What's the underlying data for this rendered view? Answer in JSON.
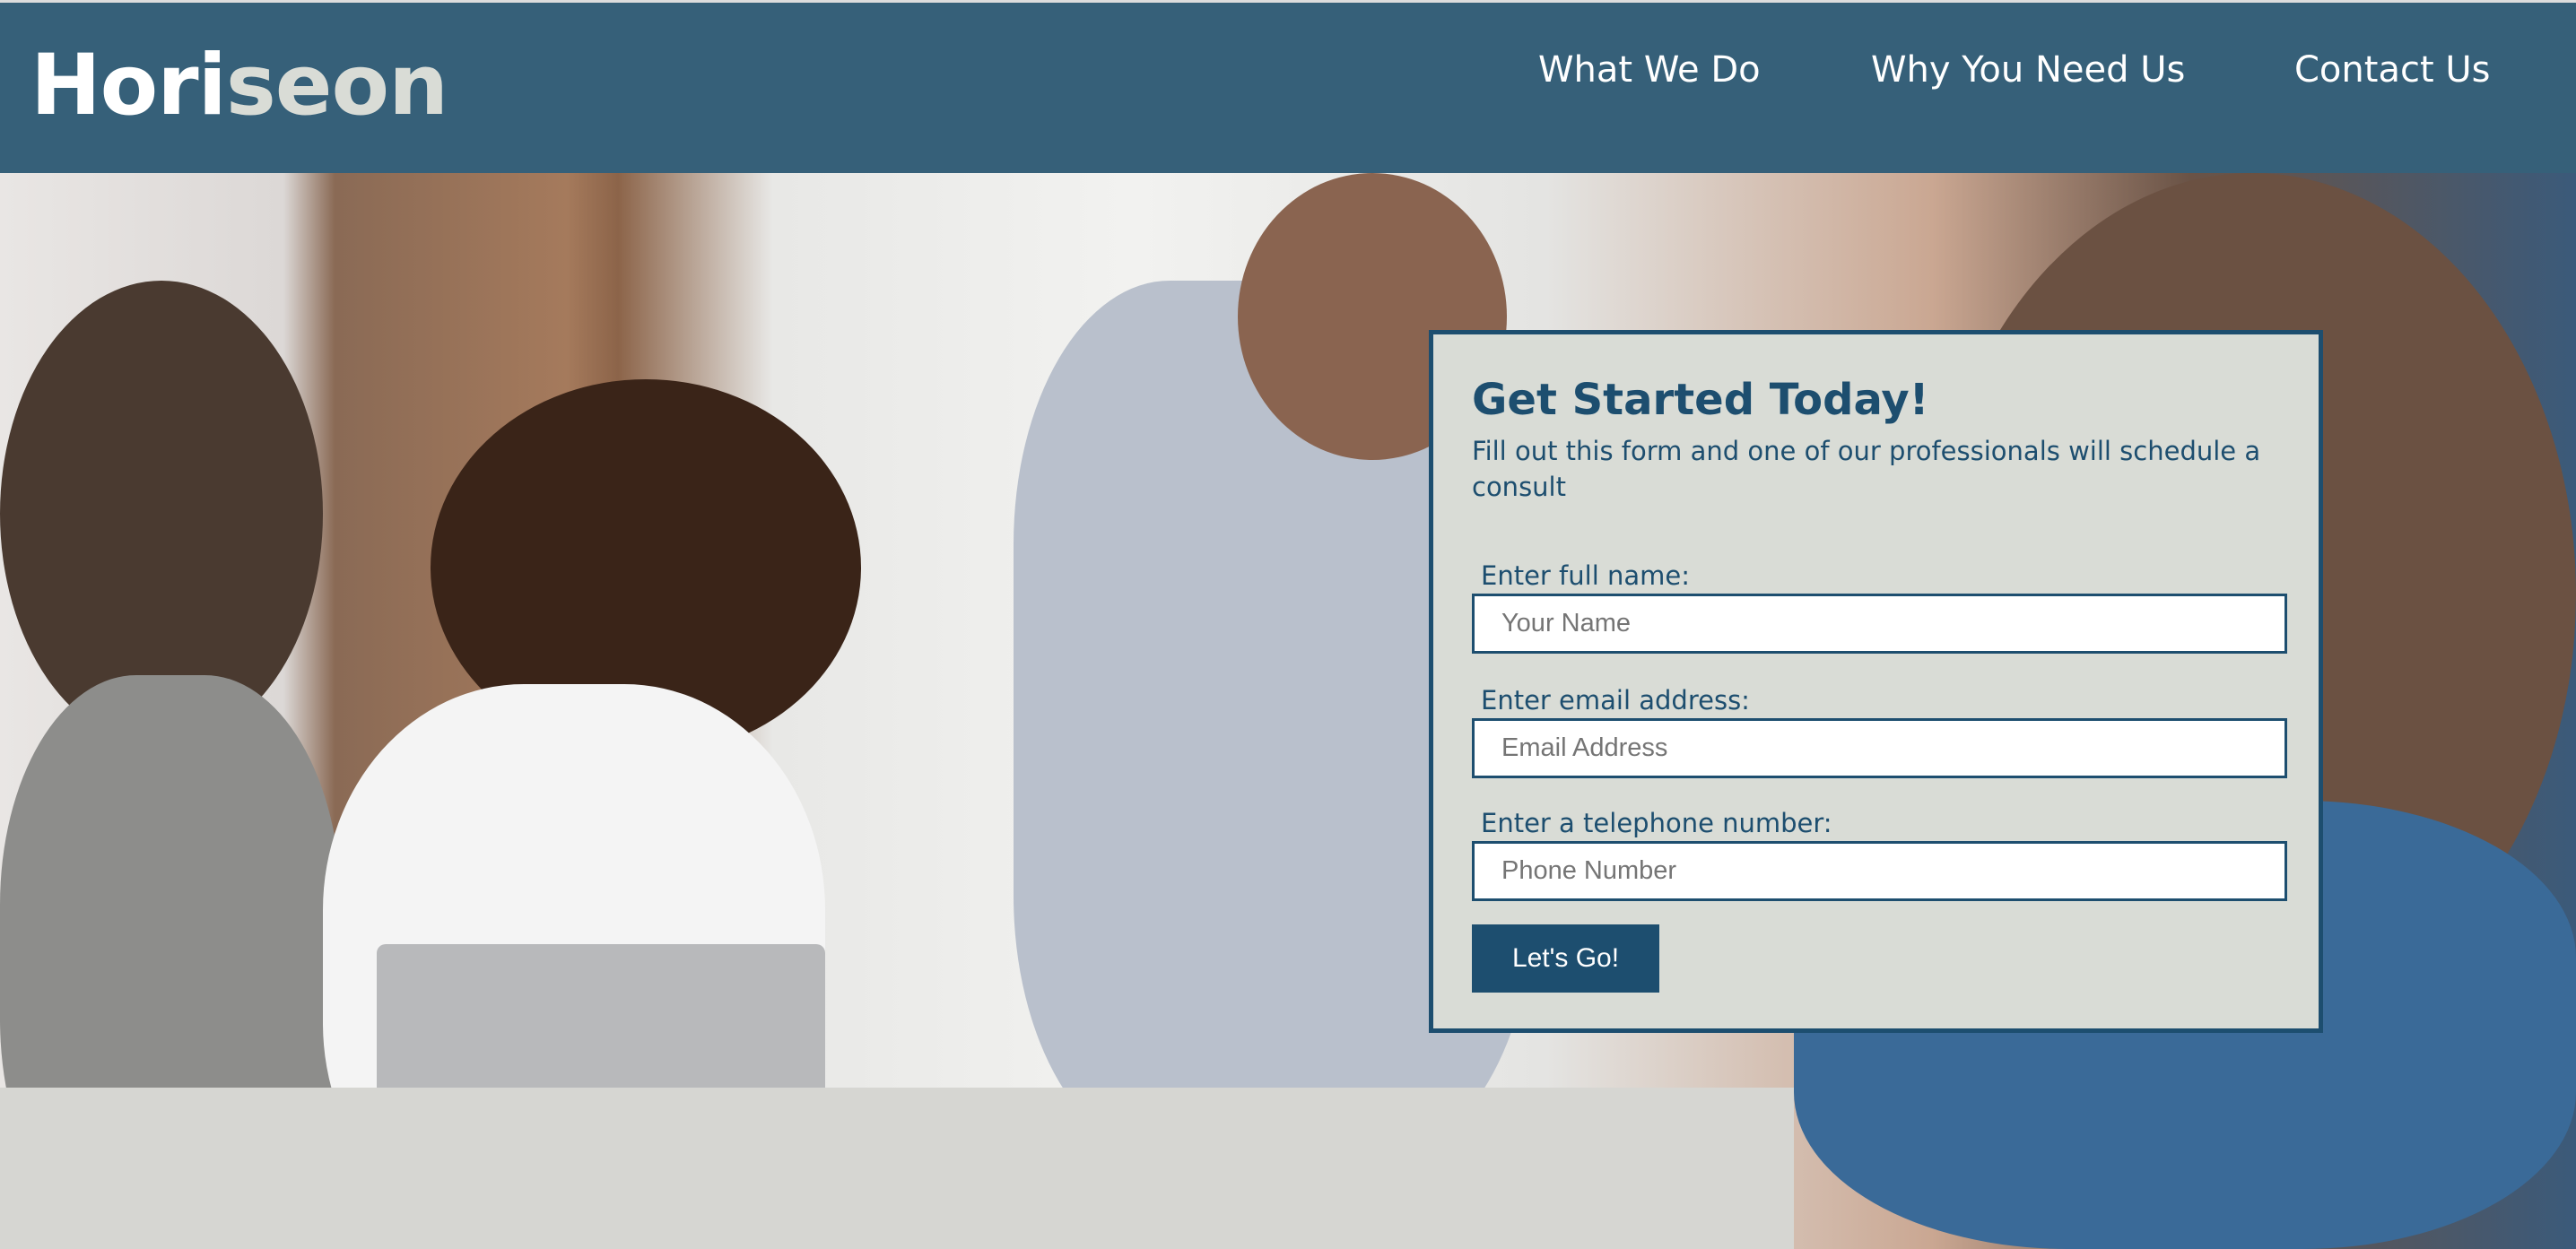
{
  "header": {
    "logo_part1": "Hori",
    "logo_part2": "seon",
    "nav": [
      "What We Do",
      "Why You Need Us",
      "Contact Us"
    ]
  },
  "form": {
    "title": "Get Started Today!",
    "description": "Fill out this form and one of our professionals will schedule a consult",
    "fields": [
      {
        "label": "Enter full name:",
        "placeholder": "Your Name"
      },
      {
        "label": "Enter email address:",
        "placeholder": "Email Address"
      },
      {
        "label": "Enter a telephone number:",
        "placeholder": "Phone Number"
      }
    ],
    "submit_label": "Let's Go!"
  },
  "colors": {
    "header": "#366079",
    "accent": "#1d4e6f",
    "form_bg": "#d9dcd6"
  }
}
